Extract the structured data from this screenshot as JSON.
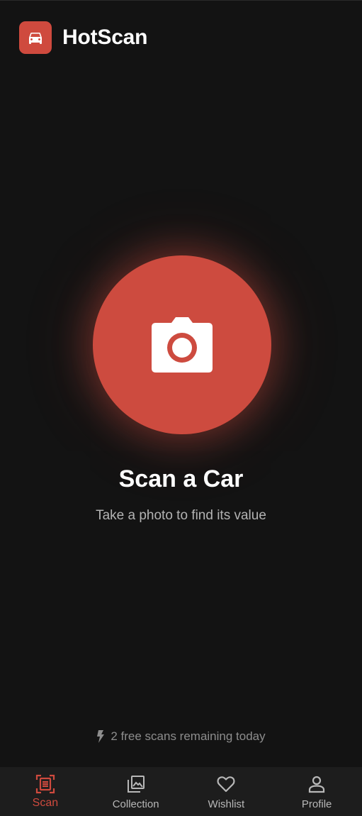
{
  "app": {
    "title": "HotScan",
    "logo_icon": "car-icon",
    "accent_color": "#cf4a3e"
  },
  "scan": {
    "button_icon": "camera-icon",
    "title": "Scan a Car",
    "subtitle": "Take a photo to find its value"
  },
  "quota": {
    "icon": "bolt-icon",
    "text": "2 free scans remaining today"
  },
  "nav": {
    "items": [
      {
        "label": "Scan",
        "icon": "scan-icon",
        "active": true
      },
      {
        "label": "Collection",
        "icon": "collection-icon",
        "active": false
      },
      {
        "label": "Wishlist",
        "icon": "heart-icon",
        "active": false
      },
      {
        "label": "Profile",
        "icon": "person-icon",
        "active": false
      }
    ]
  }
}
